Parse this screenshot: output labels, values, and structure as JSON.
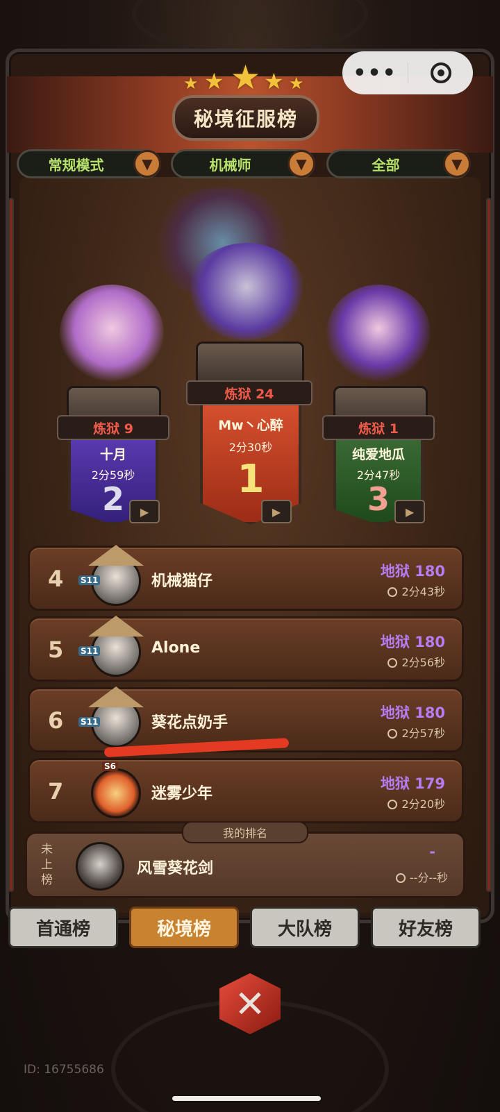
{
  "header": {
    "title": "秘境征服榜"
  },
  "filters": [
    {
      "label": "常规模式"
    },
    {
      "label": "机械师"
    },
    {
      "label": "全部"
    }
  ],
  "podium": [
    {
      "rank": "1",
      "tier": "炼狱 24",
      "name": "Mw丶心醉",
      "time": "2分30秒"
    },
    {
      "rank": "2",
      "tier": "炼狱 9",
      "name": "十月",
      "time": "2分59秒"
    },
    {
      "rank": "3",
      "tier": "炼狱 1",
      "name": "纯爱地瓜",
      "time": "2分47秒"
    }
  ],
  "rows": [
    {
      "rank": "4",
      "season": "S11",
      "name": "机械猫仔",
      "score": "地狱 180",
      "time": "2分43秒"
    },
    {
      "rank": "5",
      "season": "S11",
      "name": "Alone",
      "score": "地狱 180",
      "time": "2分56秒"
    },
    {
      "rank": "6",
      "season": "S11",
      "name": "葵花点奶手",
      "score": "地狱 180",
      "time": "2分57秒"
    },
    {
      "rank": "7",
      "season": "S6",
      "name": "迷雾少年",
      "score": "地狱 179",
      "time": "2分20秒"
    }
  ],
  "my_rank": {
    "tag": "我的排名",
    "status": "未上榜",
    "name": "风雪葵花剑",
    "score": "-",
    "time": "--分--秒"
  },
  "tabs": [
    {
      "label": "首通榜",
      "active": false
    },
    {
      "label": "秘境榜",
      "active": true
    },
    {
      "label": "大队榜",
      "active": false
    },
    {
      "label": "好友榜",
      "active": false
    }
  ],
  "footer": {
    "id_text": "ID: 16755686"
  },
  "colors": {
    "accent": "#c9822f",
    "score": "#b77cf2",
    "tier": "#f05a4a",
    "filter_text": "#b8e36a"
  },
  "icons": [
    "more-icon",
    "target-icon",
    "dropdown-arrow-icon",
    "video-icon",
    "clock-icon",
    "close-icon",
    "star-icon"
  ]
}
